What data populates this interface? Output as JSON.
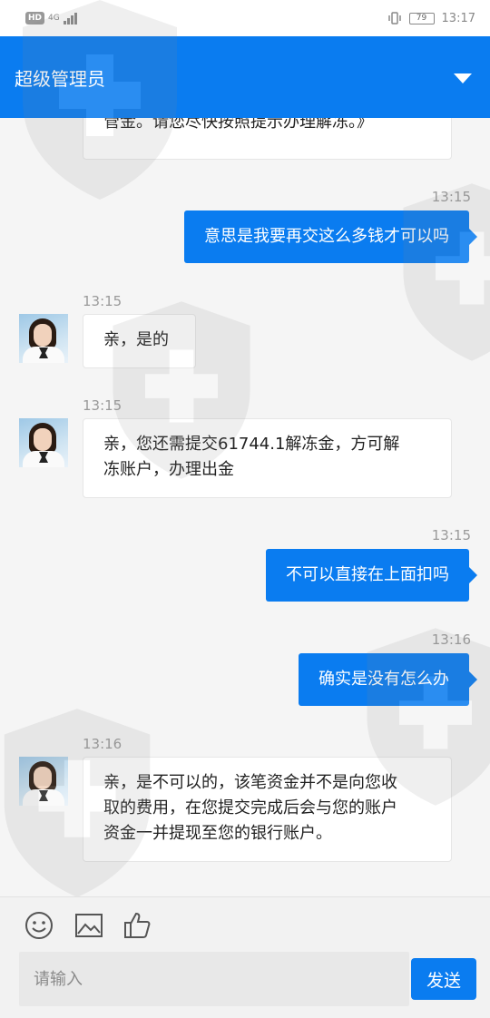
{
  "status_bar": {
    "hd_badge": "HD",
    "network": "4G",
    "battery": "79",
    "time": "13:17"
  },
  "header": {
    "title": "超级管理员",
    "dropdown_icon": "caret-down-icon"
  },
  "messages": [
    {
      "side": "in",
      "text": "管金。请您尽快按照提示办理解冻。》",
      "time": ""
    },
    {
      "side": "out",
      "text": "意思是我要再交这么多钱才可以吗",
      "time": "13:15"
    },
    {
      "side": "in",
      "text": "亲，是的",
      "time": "13:15"
    },
    {
      "side": "in",
      "lines": [
        "亲，您还需提交61744.1解冻金，方可解",
        "冻账户，办理出金"
      ],
      "time": "13:15"
    },
    {
      "side": "out",
      "text": "不可以直接在上面扣吗",
      "time": "13:15"
    },
    {
      "side": "out",
      "text": "确实是没有怎么办",
      "time": "13:16"
    },
    {
      "side": "in",
      "lines": [
        "亲，是不可以的，该笔资金并不是向您收",
        "取的费用，在您提交完成后会与您的账户",
        "资金一并提现至您的银行账户。"
      ],
      "time": "13:16"
    }
  ],
  "toolbar": {
    "icons": [
      "emoji-icon",
      "image-icon",
      "thumbs-up-icon"
    ],
    "input_placeholder": "请输入",
    "send_label": "发送"
  },
  "colors": {
    "accent": "#0a7cf0",
    "background": "#f5f5f5",
    "time_text": "#9a9a9a"
  }
}
